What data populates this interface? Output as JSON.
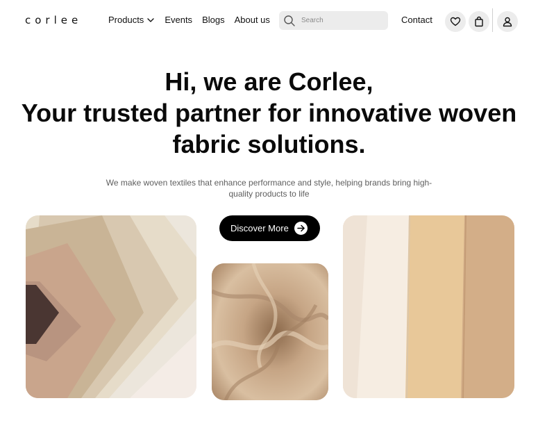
{
  "brand": {
    "logo_text": "corlee"
  },
  "nav": {
    "items": [
      {
        "label": "Products",
        "has_dropdown": true
      },
      {
        "label": "Events"
      },
      {
        "label": "Blogs"
      },
      {
        "label": "About us"
      }
    ]
  },
  "search": {
    "placeholder": "Search",
    "value": ""
  },
  "header_actions": {
    "contact_label": "Contact",
    "icons": [
      "heart-icon",
      "shopping-bag-icon",
      "user-icon"
    ]
  },
  "hero": {
    "title_lines": [
      "Hi, we are Corlee,",
      "Your trusted partner for innovative woven",
      "fabric solutions."
    ],
    "subtitle": "We make woven textiles that enhance performance and style, helping brands bring high-quality products to life",
    "cta_label": "Discover More"
  },
  "colors": {
    "accent": "#000000",
    "header_icon_bg": "#ececec",
    "subtitle_text": "#5e5e5e"
  }
}
